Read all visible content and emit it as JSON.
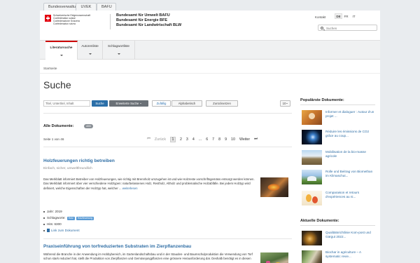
{
  "fedbar": {
    "tabs": [
      "Bundesverwaltung",
      "UVEK",
      "BAFU"
    ]
  },
  "header": {
    "confederation": [
      "Schweizerische Eidgenossenschaft",
      "Confédération suisse",
      "Confederazione Svizzera",
      "Confederaziun svizra"
    ],
    "offices": [
      "Bundesamt für Umwelt BAFU",
      "Bundesamt für Energie BFE",
      "Bundesamt für Landwirtschaft BLW"
    ],
    "contact_label": "Kontakt",
    "languages": [
      "DE",
      "FR",
      "IT"
    ],
    "active_language": "DE",
    "search_placeholder": "Suchen"
  },
  "nav": {
    "tabs": [
      "Literatursuche",
      "Autorenliste",
      "Schlagwortliste"
    ],
    "active": "Literatursuche"
  },
  "breadcrumb": "Startseite",
  "page_title": "Suche",
  "search": {
    "input_placeholder": "Titel, Untertitel, Inhalt",
    "search_button": "Suche",
    "advanced_button": "Erweiterte Suche",
    "random_button": "Zufällig",
    "alpha_button": "Alphabetisch",
    "reset_button": "Zurücksetzen",
    "page_size": "10"
  },
  "results": {
    "heading": "Alle Dokumente:",
    "count": "455",
    "page_info": "Seite 1 von 46",
    "pager": {
      "prev": "Zurück",
      "pages": [
        "1",
        "2",
        "3",
        "4",
        "...",
        "6",
        "7",
        "8",
        "9",
        "10"
      ],
      "current": "1",
      "next": "Weiter"
    },
    "items": [
      {
        "title": "Holzfeuerungen richtig betreiben",
        "subtitle": "Einfach, sicher, umweltfreundlich",
        "description": "Das Merkblatt informiert Betreiber von Holzfeuerungen, wie richtig mit Brennholz umzugehen ist und wie Holzreste vorschriftsgemäss entsorgt werden können. Das Merkblatt informiert über vier verschiedene Holztypen: naturbelassenes Holz, Restholz, Altholz und problematische Holzabfälle. Bei jedem Holztyp wird definiert, welche Eigenschaften der Holztyp hat, welcher ...",
        "more_label": "weiterlesen",
        "year": "Jahr: 2019",
        "keywords_label": "Schlagworte:",
        "keywords": [
          "Holz",
          "Holzfeuerung"
        ],
        "hits": "Hits: 6300",
        "link_label": "Link zum Dokument"
      },
      {
        "title": "Praxiseinführung von torfreduzierten Substraten im Zierpflanzenbau",
        "description": "Während die Branche in der Anwendung im Hobbybereich, im Gartenlandschaftsbau und in der Stauden- und Baumschulproduktion die Verwendung von Torf schon stark reduziert hat, stellt die Produktion von Zierpflanzen und Gemüsejungpflanzen eine grössere Herausforderung dar. Deshalb benötigt es in diesen"
      }
    ]
  },
  "sidebar": {
    "popular_title": "Populärste Dokumente:",
    "popular": [
      "Informer et dialoguer : Autour d'un projet ...",
      "Réduire les émissions de CO2 grâce au coup...",
      "Mobilisation de la bio-masse agricole",
      "Rolle und Beitrag von Biomethan im Klimaschut...",
      "Comparaison et retours d'expériences au ni..."
    ],
    "recent_title": "Aktuelle Dokumente:",
    "recent": [
      "Qualitätsrichtlinie Kom-post und Gärgut 2022...",
      "Biochar in agriculture – A systematic revie..."
    ]
  }
}
